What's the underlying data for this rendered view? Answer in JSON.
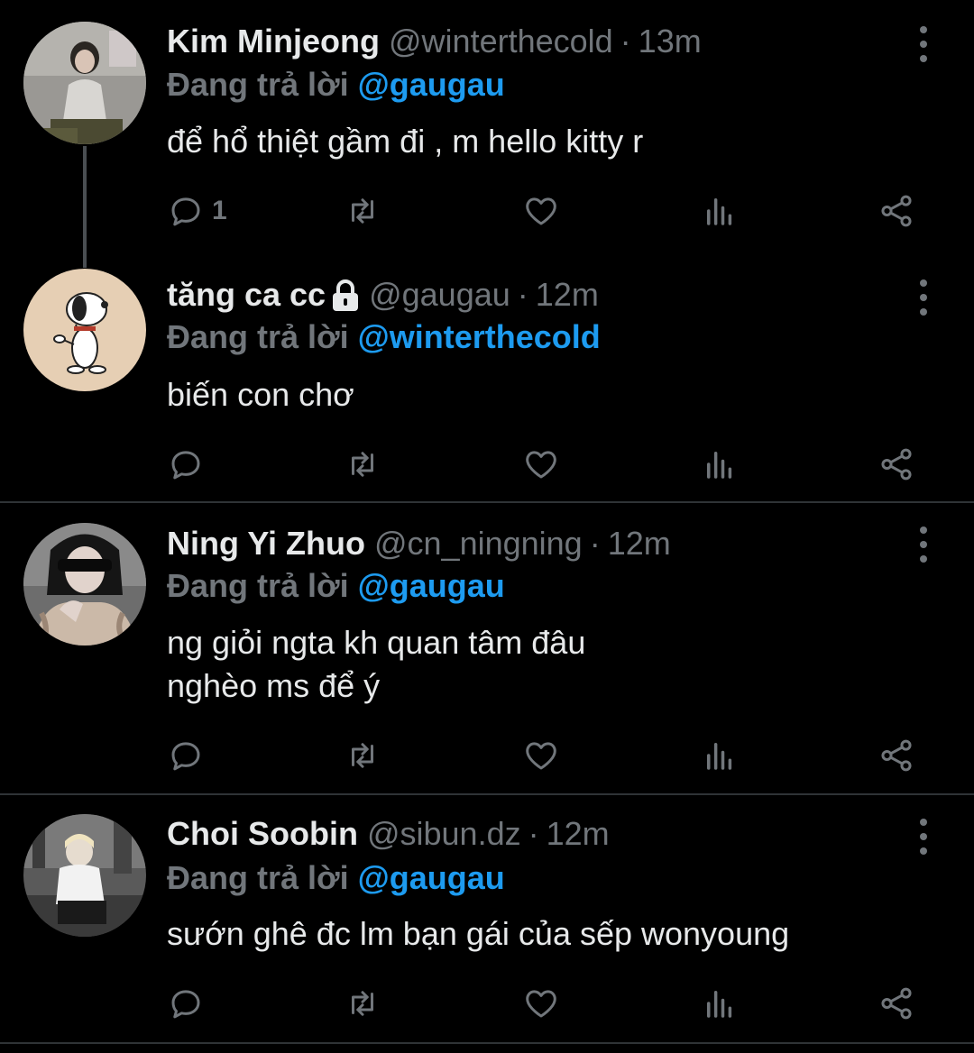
{
  "tweets": [
    {
      "name": "Kim Minjeong",
      "handle": "@winterthecold",
      "dot": "·",
      "time": "13m",
      "reply_prefix": "Đang trả lời",
      "reply_to": "@gaugau",
      "lines": [
        "để hổ thiệt gầm đi , m hello kitty r"
      ],
      "reply_count": "1",
      "avatar_icon": "avatar-photo-girl"
    },
    {
      "name": "tăng ca cc",
      "handle": "@gaugau",
      "dot": "·",
      "time": "12m",
      "reply_prefix": "Đang trả lời",
      "reply_to": "@winterthecold",
      "lines": [
        "biến con chơ"
      ],
      "reply_count": "",
      "avatar_icon": "avatar-snoopy",
      "protected": true
    },
    {
      "name": "Ning Yi Zhuo",
      "handle": "@cn_ningning",
      "dot": "·",
      "time": "12m",
      "reply_prefix": "Đang trả lời",
      "reply_to": "@gaugau",
      "lines": [
        "ng giỏi ngta kh quan tâm đâu",
        "nghèo ms để ý"
      ],
      "reply_count": "",
      "avatar_icon": "avatar-photo-sunglasses"
    },
    {
      "name": "Choi Soobin",
      "handle": "@sibun.dz",
      "dot": "·",
      "time": "12m",
      "reply_prefix": "Đang trả lời",
      "reply_to": "@gaugau",
      "lines": [
        "sướn ghê đc lm bạn gái của sếp wonyoung"
      ],
      "reply_count": "",
      "avatar_icon": "avatar-photo-street"
    }
  ],
  "colors": {
    "background": "#000000",
    "primary_text": "#e7e9ea",
    "secondary_text": "#71767b",
    "accent": "#1d9bf0",
    "divider": "#2f3336"
  }
}
